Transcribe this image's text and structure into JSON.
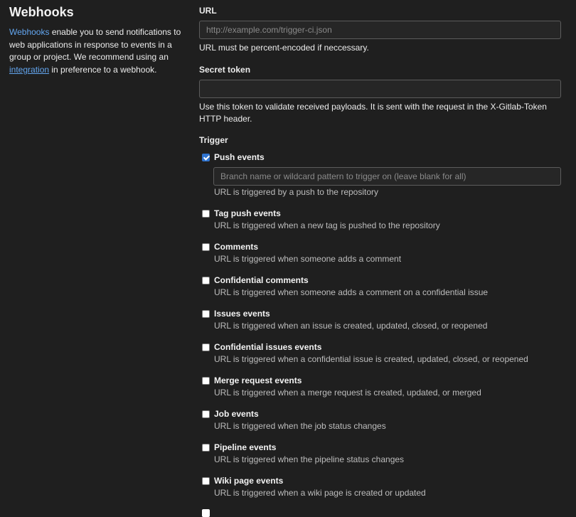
{
  "sidebar": {
    "title": "Webhooks",
    "description_link": "Webhooks",
    "description_text_1": " enable you to send notifications to web applications in response to events in a group or project. We recommend using an ",
    "integration_link": "integration",
    "description_text_2": " in preference to a webhook."
  },
  "form": {
    "url_label": "URL",
    "url_placeholder": "http://example.com/trigger-ci.json",
    "url_value": "",
    "url_help": "URL must be percent-encoded if neccessary.",
    "secret_label": "Secret token",
    "secret_value": "",
    "secret_help": "Use this token to validate received payloads. It is sent with the request in the X-Gitlab-Token HTTP header.",
    "trigger_label": "Trigger",
    "branch_placeholder": "Branch name or wildcard pattern to trigger on (leave blank for all)",
    "triggers": [
      {
        "title": "Push events",
        "desc": "URL is triggered by a push to the repository",
        "checked": true
      },
      {
        "title": "Tag push events",
        "desc": "URL is triggered when a new tag is pushed to the repository",
        "checked": false
      },
      {
        "title": "Comments",
        "desc": "URL is triggered when someone adds a comment",
        "checked": false
      },
      {
        "title": "Confidential comments",
        "desc": "URL is triggered when someone adds a comment on a confidential issue",
        "checked": false
      },
      {
        "title": "Issues events",
        "desc": "URL is triggered when an issue is created, updated, closed, or reopened",
        "checked": false
      },
      {
        "title": "Confidential issues events",
        "desc": "URL is triggered when a confidential issue is created, updated, closed, or reopened",
        "checked": false
      },
      {
        "title": "Merge request events",
        "desc": "URL is triggered when a merge request is created, updated, or merged",
        "checked": false
      },
      {
        "title": "Job events",
        "desc": "URL is triggered when the job status changes",
        "checked": false
      },
      {
        "title": "Pipeline events",
        "desc": "URL is triggered when the pipeline status changes",
        "checked": false
      },
      {
        "title": "Wiki page events",
        "desc": "URL is triggered when a wiki page is created or updated",
        "checked": false
      }
    ]
  },
  "colors": {
    "background": "#1f1f1f",
    "link": "#63a6f0",
    "checkbox_checked": "#2f74d0",
    "input_border": "#5c5c5c"
  }
}
